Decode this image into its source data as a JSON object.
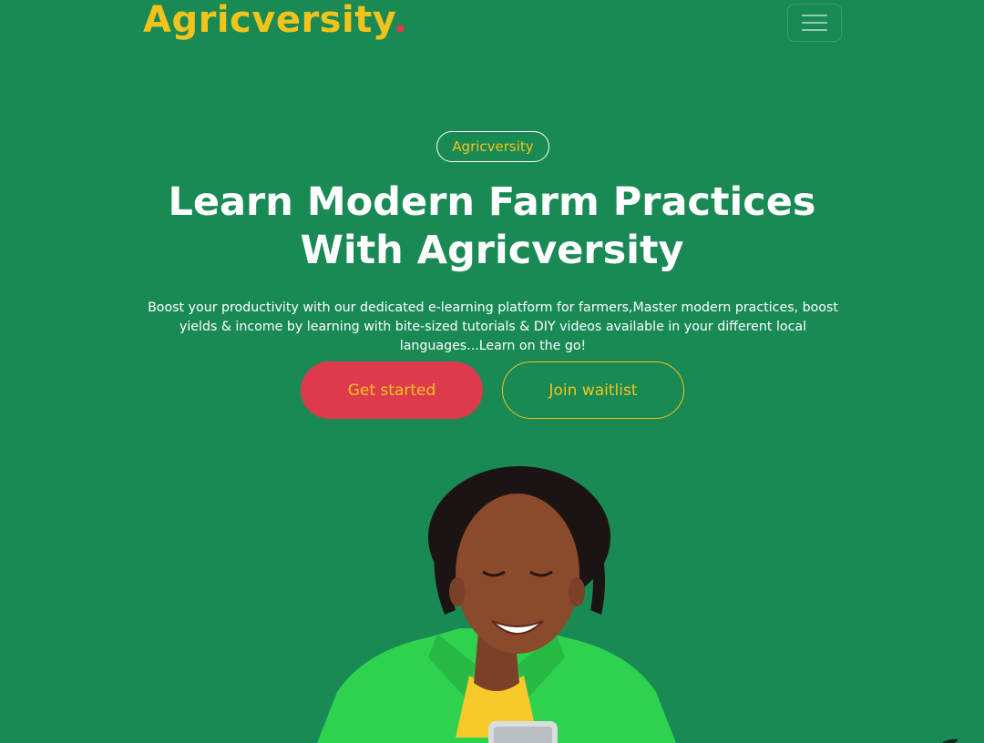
{
  "header": {
    "logo_text": "Agricversity",
    "logo_dot": ".",
    "menu_icon": "hamburger-menu-icon"
  },
  "hero": {
    "tag": "Agricversity",
    "headline": "Learn Modern Farm Practices With Agricversity",
    "description": "Boost your productivity with our dedicated e-learning platform for farmers,Master modern practices, boost yields & income by learning with bite-sized tutorials & DIY videos available in your different local languages...Learn on the go!",
    "primary_button": "Get started",
    "secondary_button": "Join waitlist",
    "image": "smiling-woman-with-phone-photo"
  },
  "colors": {
    "background": "#1a8a55",
    "accent_yellow": "#f2c31b",
    "accent_red": "#de3a4d",
    "text_white": "#ffffff"
  }
}
